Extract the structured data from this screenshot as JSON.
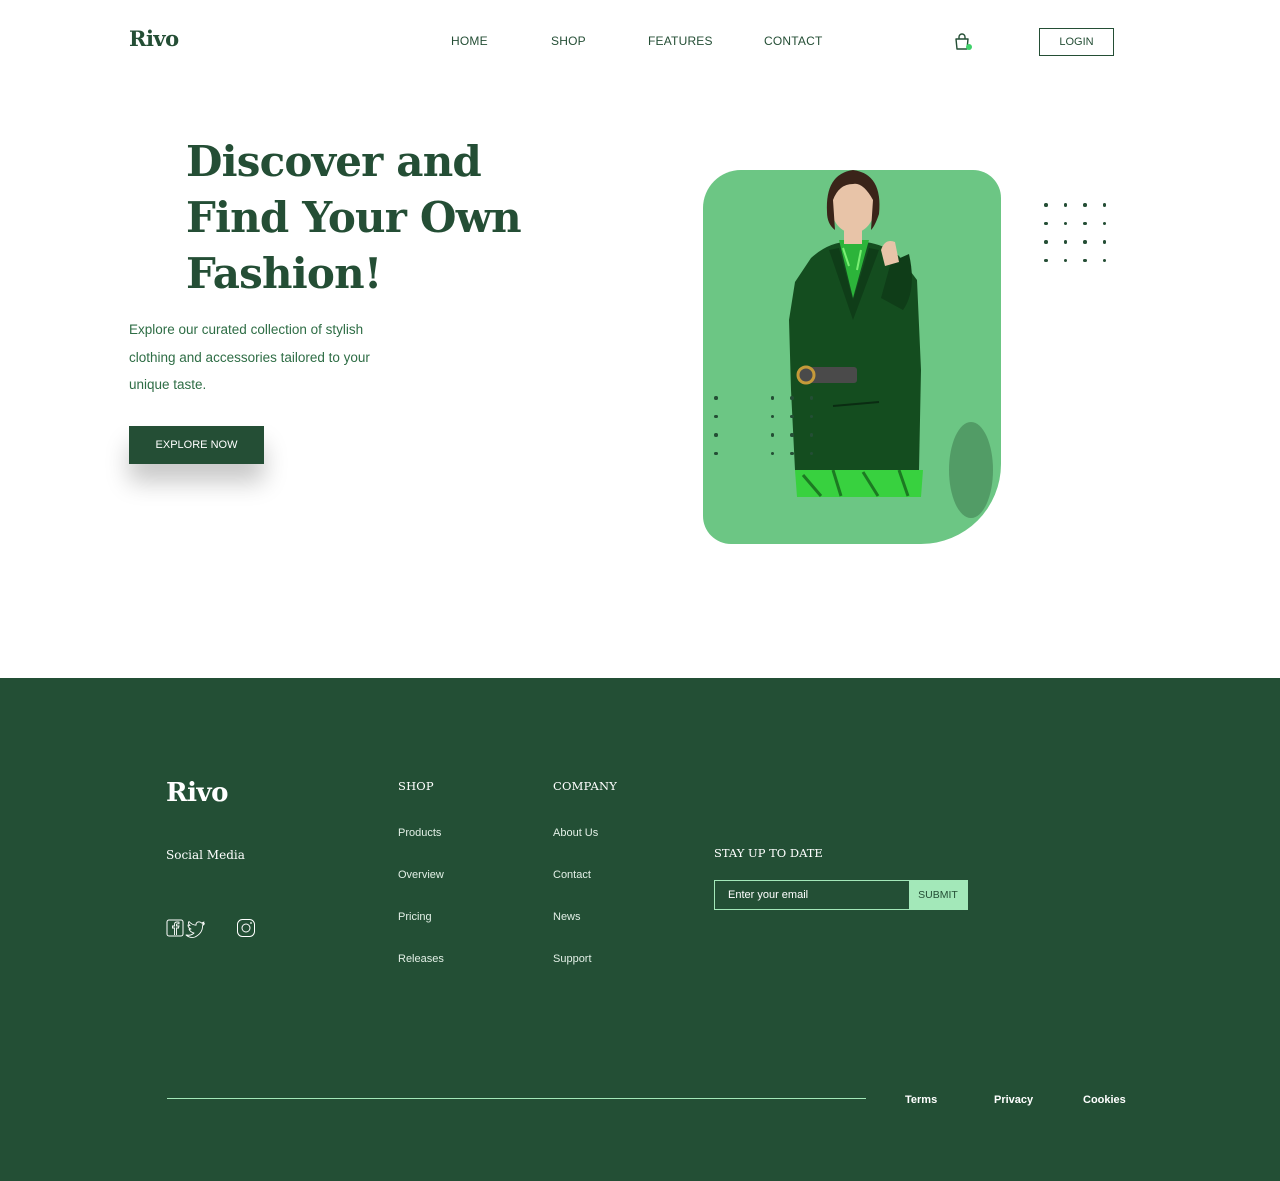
{
  "header": {
    "logo": "Rivo",
    "nav": [
      "HOME",
      "SHOP",
      "FEATURES",
      "CONTACT"
    ],
    "cart_icon": "shopping-bag-icon",
    "login_label": "LOGIN"
  },
  "hero": {
    "title_lines": [
      "Discover and",
      "Find Your Own",
      "Fashion!"
    ],
    "description_lines": [
      "Explore our curated collection of stylish",
      "clothing and accessories tailored to your",
      "unique taste."
    ],
    "cta_label": "EXPLORE NOW"
  },
  "footer": {
    "logo": "Rivo",
    "social_heading": "Social Media",
    "social_icons": [
      "facebook-icon",
      "twitter-icon",
      "instagram-icon"
    ],
    "shop": {
      "heading": "SHOP",
      "links": [
        "Products",
        "Overview",
        "Pricing",
        "Releases"
      ]
    },
    "company": {
      "heading": "COMPANY",
      "links": [
        "About Us",
        "Contact",
        "News",
        "Support"
      ]
    },
    "newsletter": {
      "heading": "STAY UP TO DATE",
      "placeholder": "Enter your email",
      "submit_label": "SUBMIT"
    },
    "legal": [
      "Terms",
      "Privacy",
      "Cookies"
    ]
  },
  "colors": {
    "primary_dark_green": "#244e35",
    "card_green": "#6cc684",
    "accent_mint": "#a3e8b9",
    "footer_bg": "#234f35"
  }
}
